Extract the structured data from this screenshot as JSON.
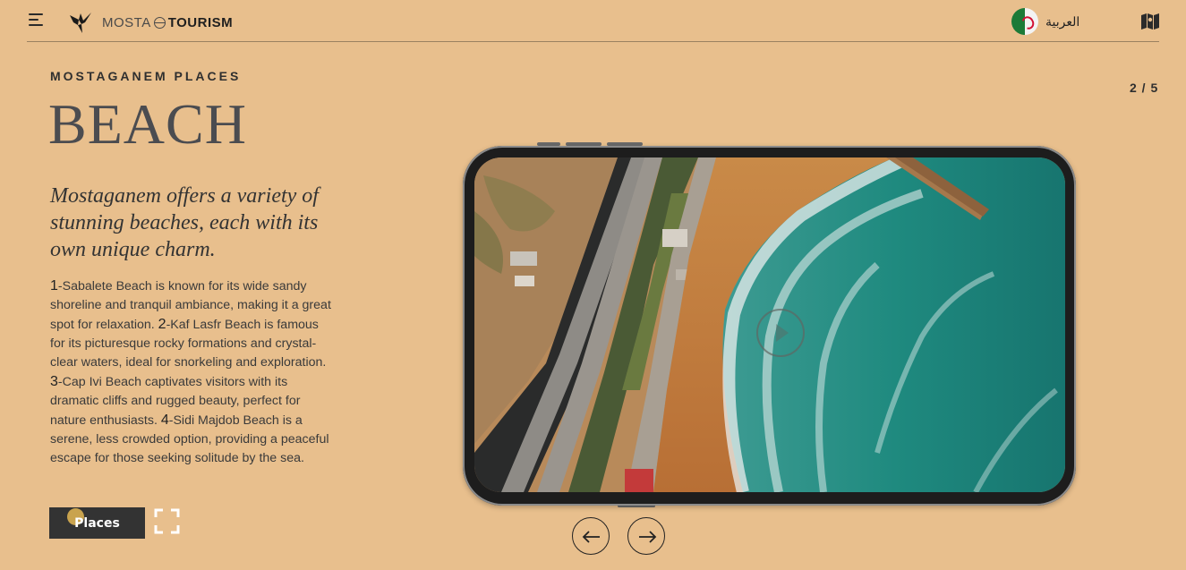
{
  "header": {
    "logo": {
      "thin": "MOSTA",
      "bold": "TOURISM"
    },
    "language": {
      "label": "العربية",
      "flag_icon": "algeria-flag-icon"
    },
    "map_icon": "map-icon",
    "menu_icon": "hamburger-menu-icon"
  },
  "section": {
    "eyebrow": "MOSTAGANEM PLACES",
    "title": "BEACH",
    "tagline": "Mostaganem offers a variety of stunning beaches, each with its own unique charm.",
    "items": [
      {
        "num": "1",
        "text": "-Sabalete Beach is known for its wide sandy shoreline and tranquil ambiance, making it a great spot for relaxation. "
      },
      {
        "num": "2",
        "text": "-Kaf Lasfr Beach is famous for its picturesque rocky formations and crystal-clear waters, ideal for snorkeling and exploration. "
      },
      {
        "num": "3",
        "text": "-Cap Ivi Beach captivates visitors with its dramatic cliffs and rugged beauty, perfect for nature enthusiasts. "
      },
      {
        "num": "4",
        "text": "-Sidi Majdob Beach is a serene, less crowded option, providing a peaceful escape for those seeking solitude by the sea."
      }
    ],
    "places_button": "Places"
  },
  "slider": {
    "counter": "2 / 5"
  },
  "colors": {
    "background": "#e8bf8d",
    "button": "#333333",
    "accent_dot": "#c9a34e"
  }
}
